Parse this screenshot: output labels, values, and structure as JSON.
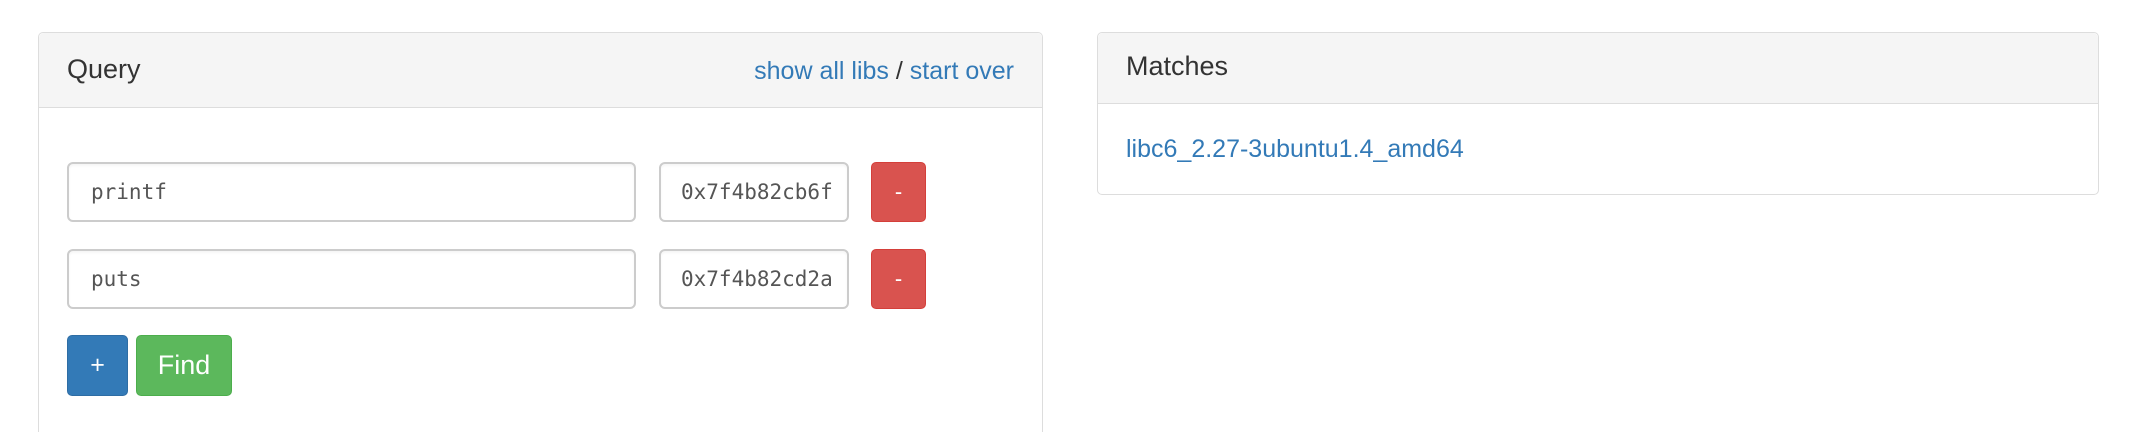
{
  "query": {
    "title": "Query",
    "show_all_libs": "show all libs",
    "separator": "/",
    "start_over": "start over",
    "rows": [
      {
        "symbol": "printf",
        "address": "0x7f4b82cb6f",
        "remove_label": "-"
      },
      {
        "symbol": "puts",
        "address": "0x7f4b82cd2a",
        "remove_label": "-"
      }
    ],
    "add_label": "+",
    "find_label": "Find"
  },
  "matches": {
    "title": "Matches",
    "items": [
      "libc6_2.27-3ubuntu1.4_amd64"
    ]
  },
  "colors": {
    "link": "#337ab7",
    "danger": "#d9534f",
    "primary": "#337ab7",
    "success": "#5cb85c"
  }
}
